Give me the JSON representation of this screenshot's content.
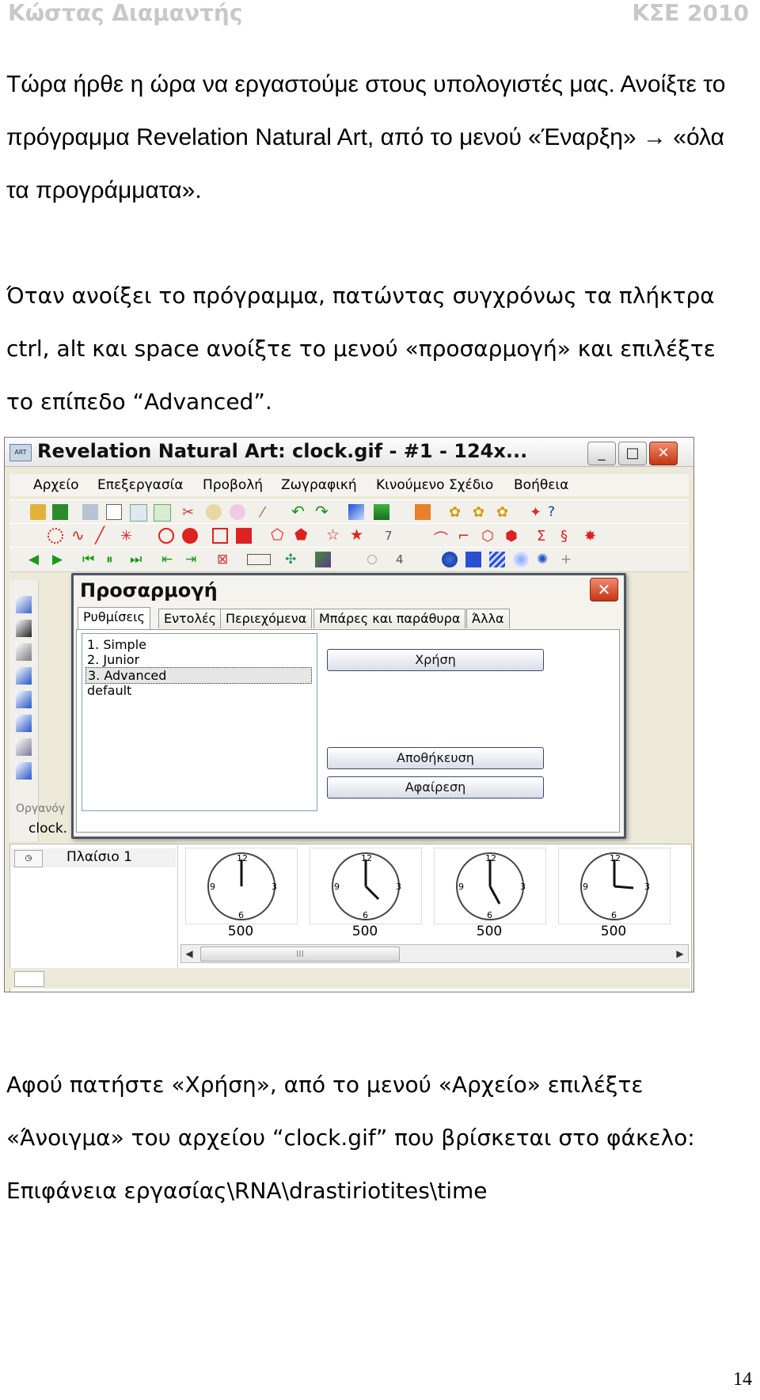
{
  "header": {
    "author": "Κώστας Διαμαντής",
    "course": "ΚΣΕ 2010"
  },
  "paragraph1": "Τώρα ήρθε η ώρα να εργαστούμε στους υπολογιστές μας. Ανοίξτε το πρόγραμμα Revelation Natural Art, από το μενού «Έναρξη» → «όλα τα προγράμματα».",
  "paragraph2": "Όταν ανοίξει το πρόγραμμα, πατώντας συγχρόνως τα πλήκτρα ctrl, alt και space ανοίξτε το μενού «προσαρμογή» και επιλέξτε το επίπεδο “Advanced”.",
  "paragraph3": "Αφού πατήστε «Χρήση», από το μενού «Αρχείο» επιλέξτε «Άνοιγμα» του αρχείου “clock.gif” που βρίσκεται στο φάκελο: Επιφάνεια εργασίας\\RNA\\drastiriotites\\time",
  "page_number": "14",
  "screenshot": {
    "app_icon": "ART",
    "window_title": "Revelation Natural Art: clock.gif - #1 - 124x...",
    "window_buttons": {
      "minimize": "_",
      "maximize": "□",
      "close": "✕"
    },
    "menu": [
      "Αρχείο",
      "Επεξεργασία",
      "Προβολή",
      "Ζωγραφική",
      "Κινούμενο Σχέδιο",
      "Βοήθεια"
    ],
    "toolbar_numbers": {
      "lines": "7",
      "sides": "4"
    },
    "organizer_label": "Οργανόγ",
    "organizer_tab": "clock.",
    "frame_label": "Πλαίσιο 1",
    "frame_delays": [
      "500",
      "500",
      "500",
      "500"
    ],
    "scroll_grip": "III",
    "dialog": {
      "title": "Προσαρμογή",
      "close": "✕",
      "tabs": [
        "Ρυθμίσεις",
        "Εντολές",
        "Περιεχόμενα",
        "Μπάρες και παράθυρα",
        "Άλλα"
      ],
      "levels": [
        "1. Simple",
        "2. Junior",
        "3. Advanced",
        "default"
      ],
      "selected_level": "3. Advanced",
      "buttons": {
        "use": "Χρήση",
        "save": "Αποθήκευση",
        "remove": "Αφαίρεση"
      }
    }
  },
  "colors": {
    "header_gray": "#c8c8c8",
    "close_red": "#c43512",
    "selection": "#e6e6e6"
  }
}
